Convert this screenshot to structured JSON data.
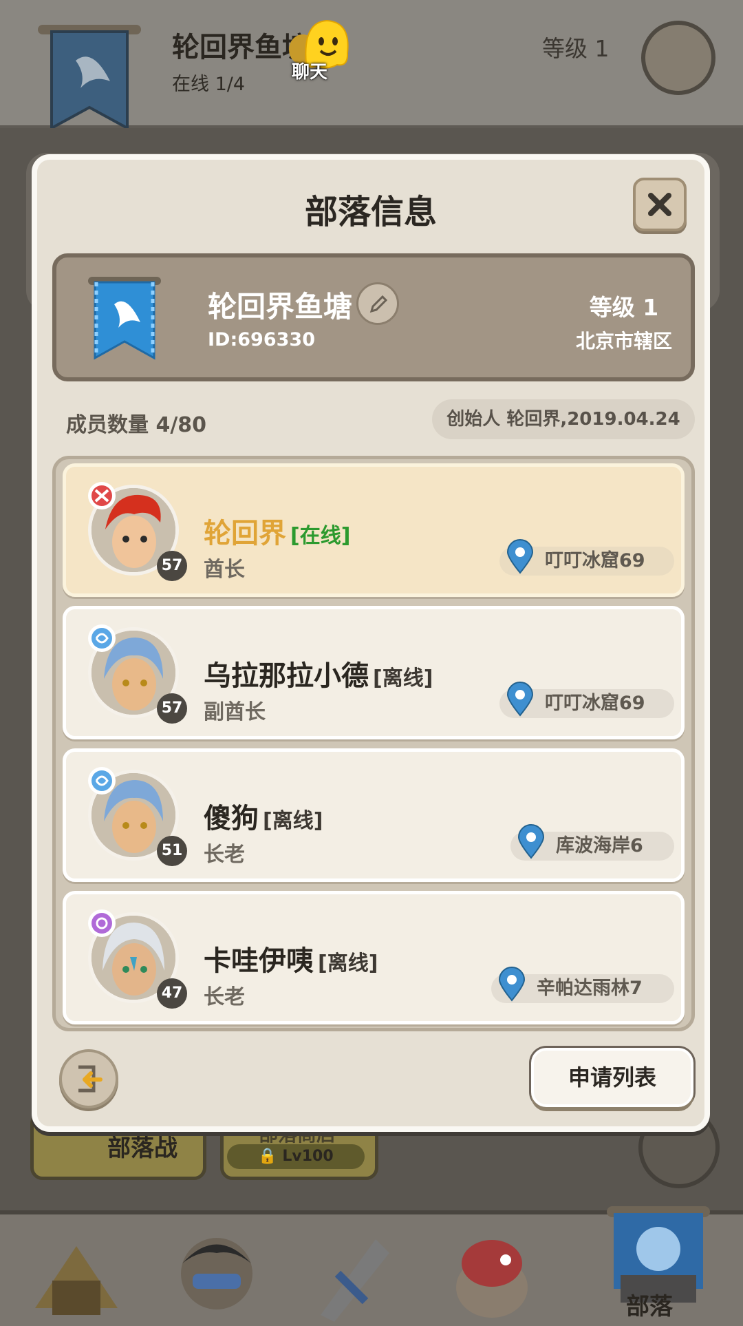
{
  "background": {
    "tribe_title": "轮回界鱼塘",
    "online": "在线 1/4",
    "level": "等级 1",
    "chat_label": "聊天",
    "tribe_war_button": "部落战",
    "tribe_shop_button": "部落商店",
    "tribe_shop_lock": "Lv100",
    "nav_active_label": "部落"
  },
  "modal": {
    "title": "部落信息",
    "tribe": {
      "name": "轮回界鱼塘",
      "id": "ID:696330",
      "level": "等级 1",
      "location": "北京市辖区"
    },
    "member_count": "成员数量 4/80",
    "founder": "创始人 轮回界,2019.04.24",
    "members": [
      {
        "name": "轮回界",
        "status": "[在线]",
        "role": "酋长",
        "level": "57",
        "location": "叮叮冰窟69"
      },
      {
        "name": "乌拉那拉小德",
        "status": "[离线]",
        "role": "副酋长",
        "level": "57",
        "location": "叮叮冰窟69"
      },
      {
        "name": "傻狗",
        "status": "[离线]",
        "role": "长老",
        "level": "51",
        "location": "库波海岸6"
      },
      {
        "name": "卡哇伊咦",
        "status": "[离线]",
        "role": "长老",
        "level": "47",
        "location": "辛帕达雨林7"
      }
    ],
    "apply_list_button": "申请列表"
  },
  "colors": {
    "online_green": "#2c9a2e",
    "self_name_gold": "#e0a437",
    "banner_blue": "#2f8fd6"
  }
}
